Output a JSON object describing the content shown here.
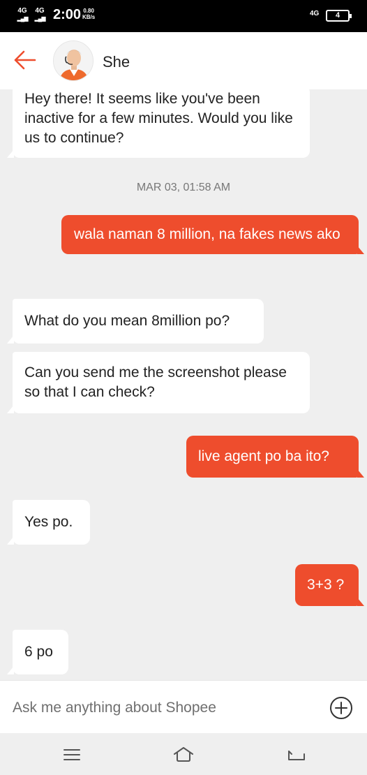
{
  "status_bar": {
    "sim1": "4G",
    "sim2": "4G",
    "time": "2:00",
    "speed_value": "0.80",
    "speed_unit": "KB/s",
    "network_right": "4G",
    "battery": "4"
  },
  "header": {
    "name": "She"
  },
  "messages": [
    {
      "from": "agent",
      "text": "Hey there! It seems like you've been inactive for a few minutes. Would you like us to continue?"
    },
    {
      "from": "user",
      "text": "wala naman 8 million, na fakes news ako"
    },
    {
      "from": "agent",
      "text": "What do you mean 8million po?"
    },
    {
      "from": "agent",
      "text": "Can you send me the screenshot please so that I can check?"
    },
    {
      "from": "user",
      "text": "live agent po ba ito?"
    },
    {
      "from": "agent",
      "text": "Yes po."
    },
    {
      "from": "user",
      "text": "3+3 ?"
    },
    {
      "from": "agent",
      "text": "6 po"
    }
  ],
  "timestamp": "MAR 03, 01:58 AM",
  "composer": {
    "placeholder": "Ask me anything about Shopee"
  },
  "colors": {
    "accent": "#ee4d2d",
    "background": "#efefef",
    "incoming_bubble": "#ffffff"
  },
  "icons": [
    "back-arrow-icon",
    "add-circle-icon",
    "menu-icon",
    "home-icon",
    "back-nav-icon"
  ]
}
